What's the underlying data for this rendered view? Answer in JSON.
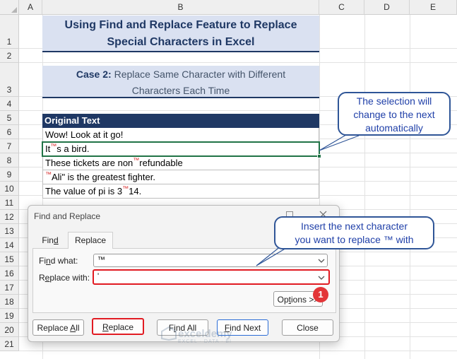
{
  "columns": [
    "A",
    "B",
    "C",
    "D",
    "E"
  ],
  "rows": [
    "1",
    "2",
    "3",
    "4",
    "5",
    "6",
    "7",
    "8",
    "9",
    "10",
    "11",
    "12",
    "13",
    "14",
    "15",
    "16",
    "17",
    "18",
    "19",
    "20",
    "21"
  ],
  "title": {
    "line1": "Using Find and Replace Feature to Replace",
    "line2": "Special Characters in Excel"
  },
  "case_band": {
    "label": "Case 2:",
    "line1": " Replace Same Character with Different",
    "line2": "Characters Each Time"
  },
  "table": {
    "header": "Original Text",
    "rows": [
      {
        "before": "Wow! Look at it go!",
        "tm": "",
        "after": ""
      },
      {
        "before": "It",
        "tm": "™",
        "after": "s a bird."
      },
      {
        "before": "These tickets are non",
        "tm": "™",
        "after": "refundable"
      },
      {
        "before": "",
        "tm": "™",
        "after": "Ali\" is the greatest fighter."
      },
      {
        "before": "The value of pi is 3",
        "tm": "™",
        "after": "14."
      }
    ]
  },
  "callouts": {
    "selection": {
      "line1": "The selection will",
      "line2": "change to the next",
      "line3": "automatically"
    },
    "insert": {
      "line1": "Insert the next character",
      "line2": "you want to replace ™ with"
    }
  },
  "dialog": {
    "title": "Find and Replace",
    "tabs": [
      {
        "pre": "Fin",
        "hot": "d",
        "post": ""
      },
      {
        "pre": "Re",
        "hot": "p",
        "post": "lace"
      }
    ],
    "find_label": {
      "pre": "Fi",
      "hot": "n",
      "post": "d what:"
    },
    "find_value": "™",
    "replace_label": {
      "pre": "R",
      "hot": "e",
      "post": "place with:"
    },
    "replace_value": "'",
    "options": {
      "pre": "Op",
      "hot": "t",
      "post": "ions >>"
    },
    "buttons": {
      "replace_all": {
        "pre": "Replace ",
        "hot": "A",
        "post": "ll"
      },
      "replace": {
        "pre": "",
        "hot": "R",
        "post": "eplace"
      },
      "find_all": {
        "pre": "F",
        "hot": "i",
        "post": "nd All"
      },
      "find_next": {
        "pre": "",
        "hot": "F",
        "post": "ind Next"
      },
      "close": "Close"
    },
    "badge": "1"
  },
  "watermark": {
    "name": "exceldemy",
    "tagline": "EXCEL · DATA · BI"
  },
  "colors": {
    "accent": "#1f3864",
    "band": "#dae1f1",
    "highlight_red": "#e11b22",
    "callout_blue": "#2f5597",
    "excel_green": "#217346"
  }
}
